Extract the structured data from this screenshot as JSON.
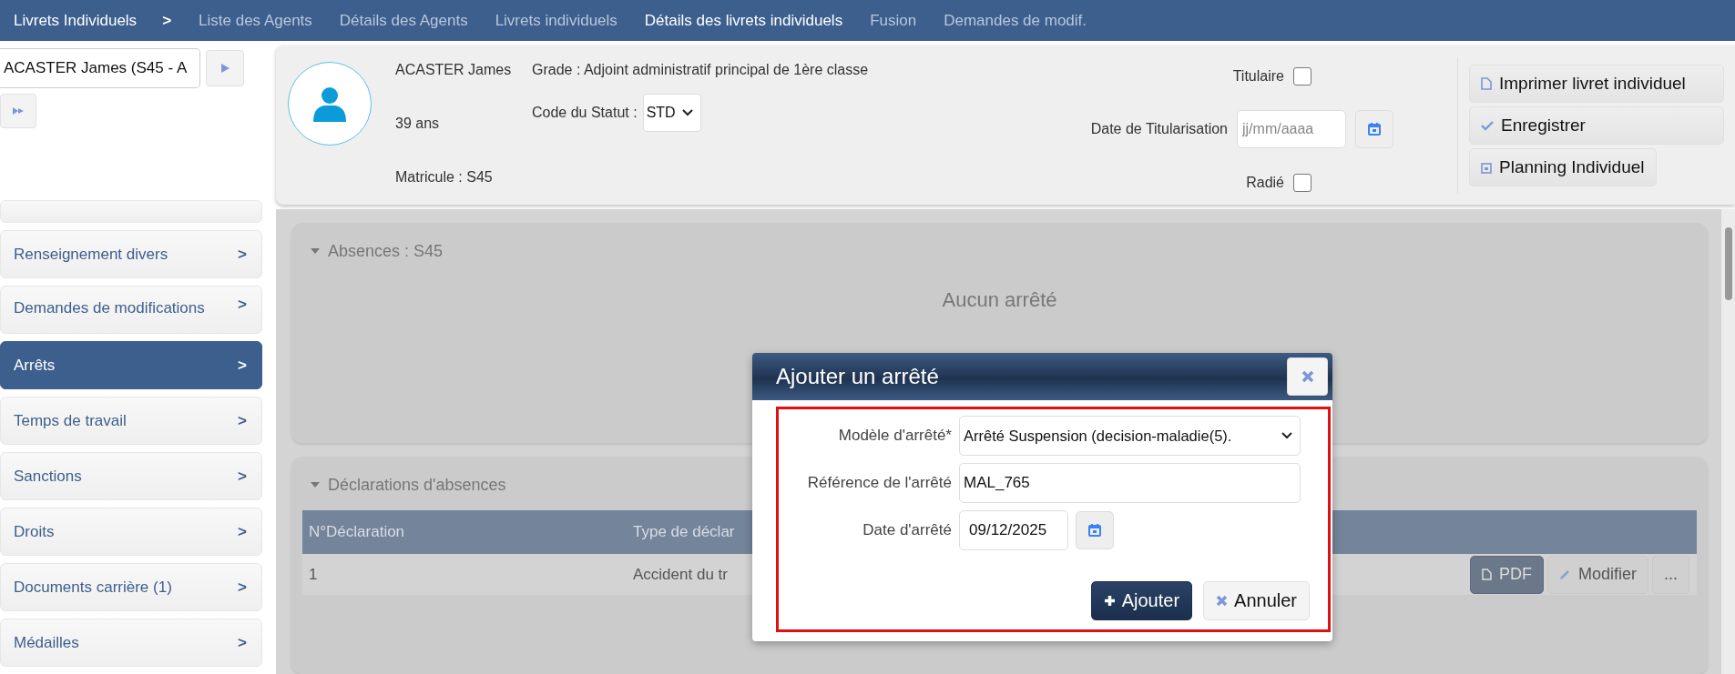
{
  "nav": {
    "title": "Livrets Individuels",
    "separator": ">",
    "tabs": [
      {
        "label": "Liste des Agents",
        "selected": false
      },
      {
        "label": "Détails des Agents",
        "selected": false
      },
      {
        "label": "Livrets individuels",
        "selected": false
      },
      {
        "label": "Détails des livrets individuels",
        "selected": true
      },
      {
        "label": "Fusion",
        "selected": false
      },
      {
        "label": "Demandes de modif.",
        "selected": false
      }
    ]
  },
  "agent_picker": {
    "value": "ACASTER James (S45 - A"
  },
  "sidebar": {
    "items": [
      {
        "label": "Renseignement divers",
        "arrow": ">",
        "selected": false
      },
      {
        "label": "Demandes de modifications",
        "arrow": ">",
        "selected": false
      },
      {
        "label": "Arrêts",
        "arrow": ">",
        "selected": true
      },
      {
        "label": "Temps de travail",
        "arrow": ">",
        "selected": false
      },
      {
        "label": "Sanctions",
        "arrow": ">",
        "selected": false
      },
      {
        "label": "Droits",
        "arrow": ">",
        "selected": false
      },
      {
        "label": "Documents carrière (1)",
        "arrow": ">",
        "selected": false
      },
      {
        "label": "Médailles",
        "arrow": ">",
        "selected": false
      }
    ]
  },
  "profile": {
    "name": "ACASTER James",
    "age": "39 ans",
    "matricule": "Matricule : S45",
    "grade": "Grade : Adjoint administratif principal de 1ère classe",
    "statut_label": "Code du Statut :",
    "statut_value": "STD",
    "titulaire": {
      "label": "Titulaire",
      "checked": false
    },
    "date_titularisation": {
      "label": "Date de Titularisation",
      "placeholder": "jj/mm/aaaa"
    },
    "radie": {
      "label": "Radié",
      "checked": false
    }
  },
  "actions": [
    {
      "kind": "print",
      "label": "Imprimer livret individuel"
    },
    {
      "kind": "save",
      "label": "Enregistrer"
    },
    {
      "kind": "planning",
      "label": "Planning Individuel"
    }
  ],
  "absences": {
    "title": "Absences : S45",
    "expanded": true,
    "empty_text": "Aucun arrêté"
  },
  "declarations": {
    "title": "Déclarations d'absences",
    "expanded": true,
    "columns": [
      "N°Déclaration",
      "Type de déclar"
    ],
    "rows": [
      {
        "cells": [
          "1",
          "Accident du tr"
        ],
        "actions": [
          {
            "kind": "pdf",
            "label": "PDF"
          },
          {
            "kind": "edit",
            "label": "Modifier"
          },
          {
            "kind": "more",
            "label": "..."
          }
        ]
      }
    ]
  },
  "modal": {
    "title": "Ajouter un arrêté",
    "fields": [
      {
        "kind": "select",
        "label": "Modèle d'arrêté*",
        "value": "Arrêté Suspension (decision-maladie(5)."
      },
      {
        "kind": "text",
        "label": "Référence de l'arrêté",
        "value": "MAL_765"
      },
      {
        "kind": "date",
        "label": "Date d'arrêté",
        "value": "09/12/2025"
      }
    ],
    "buttons": [
      {
        "kind": "primary",
        "label": "Ajouter"
      },
      {
        "kind": "cancel",
        "label": "Annuler"
      }
    ]
  }
}
